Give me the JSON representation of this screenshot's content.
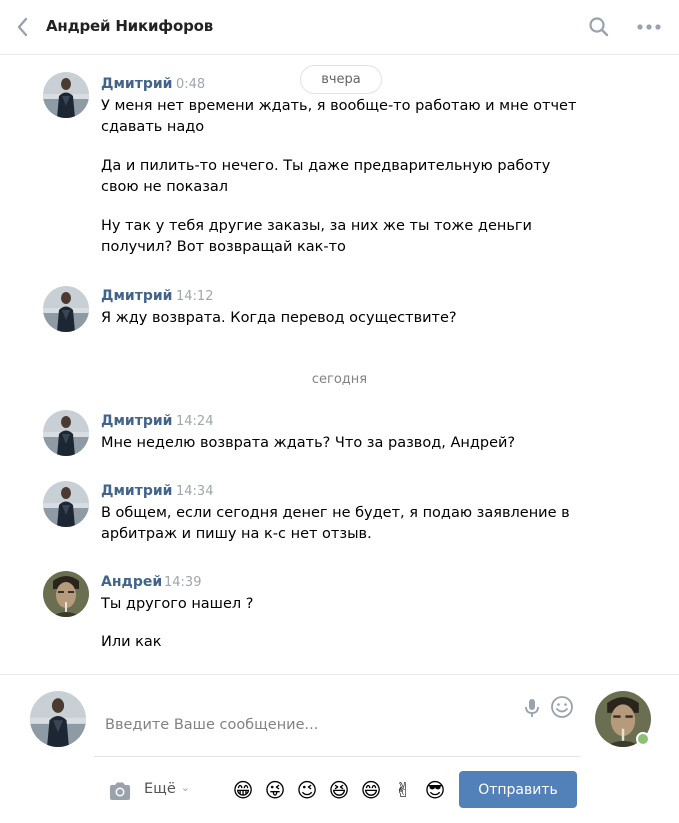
{
  "header": {
    "title": "Андрей Никифоров"
  },
  "dates": {
    "yesterday": "вчера",
    "today": "сегодня"
  },
  "messages": [
    {
      "author": "Дмитрий",
      "time": "0:48",
      "texts": [
        "У меня нет времени ждать, я вообще-то работаю и мне отчет сдавать надо",
        "Да и пилить-то нечего. Ты даже предварительную работу свою не показал",
        "Ну так у тебя другие заказы, за них же ты тоже деньги получил? Вот возвращай как-то"
      ]
    },
    {
      "author": "Дмитрий",
      "time": "14:12",
      "texts": [
        "Я жду возврата. Когда перевод осуществите?"
      ]
    },
    {
      "author": "Дмитрий",
      "time": "14:24",
      "texts": [
        "Мне неделю возврата ждать? Что за развод, Андрей?"
      ]
    },
    {
      "author": "Дмитрий",
      "time": "14:34",
      "texts": [
        "В общем, если сегодня денег не будет, я подаю заявление в арбитраж и пишу на к-с нет отзыв."
      ]
    },
    {
      "author": "Андрей",
      "time": "14:39",
      "texts": [
        "Ты другого нашел ?",
        "Или как"
      ]
    }
  ],
  "composer": {
    "placeholder": "Введите Ваше сообщение...",
    "more_label": "Ещё",
    "send_label": "Отправить",
    "emojis": [
      "😁",
      "😜",
      "😉",
      "😆",
      "😄",
      "✌",
      "😎"
    ]
  },
  "colors": {
    "author": "#42648b",
    "send_button": "#5181b8",
    "online": "#8ac176"
  }
}
